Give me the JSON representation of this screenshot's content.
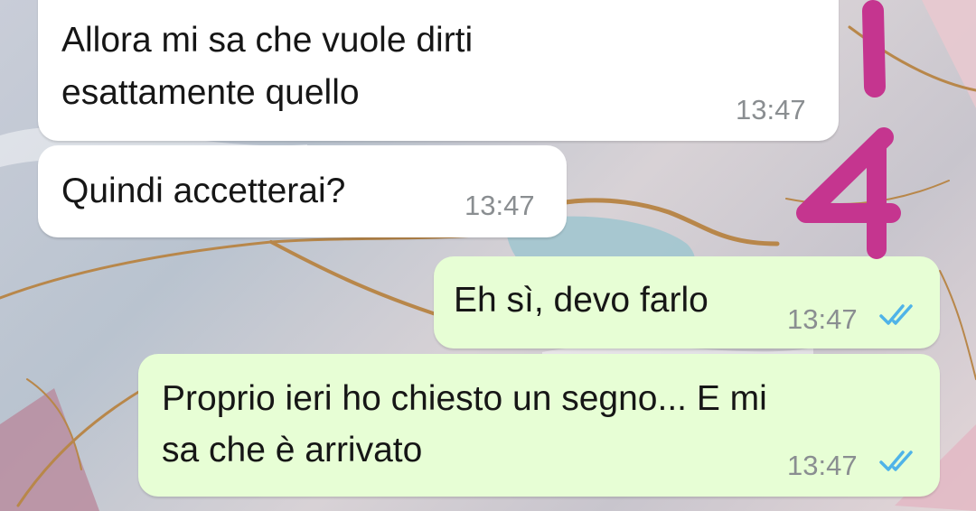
{
  "messages": [
    {
      "direction": "incoming",
      "text_lines": [
        "Allora mi sa che vuole dirti",
        "esattamente quello"
      ],
      "time": "13:47"
    },
    {
      "direction": "incoming",
      "text_lines": [
        "Quindi accetterai?"
      ],
      "time": "13:47"
    },
    {
      "direction": "outgoing",
      "text_lines": [
        "Eh sì, devo farlo"
      ],
      "time": "13:47",
      "status": "read",
      "status_icon": "double-check-icon"
    },
    {
      "direction": "outgoing",
      "text_lines": [
        "Proprio ieri ho chiesto un segno... E mi",
        "sa che è arrivato"
      ],
      "time": "13:47",
      "status": "read",
      "status_icon": "double-check-icon"
    }
  ],
  "overlay": {
    "annotation_text": "14",
    "color": "#c5358f"
  },
  "colors": {
    "incoming_bubble": "#ffffff",
    "outgoing_bubble": "#e7fed5",
    "read_ticks": "#4fb3e8",
    "timestamp": "#8a8e91",
    "wallpaper_gold_veins": "#b8874a",
    "wallpaper_teal_pool": "#9fc6cf"
  }
}
